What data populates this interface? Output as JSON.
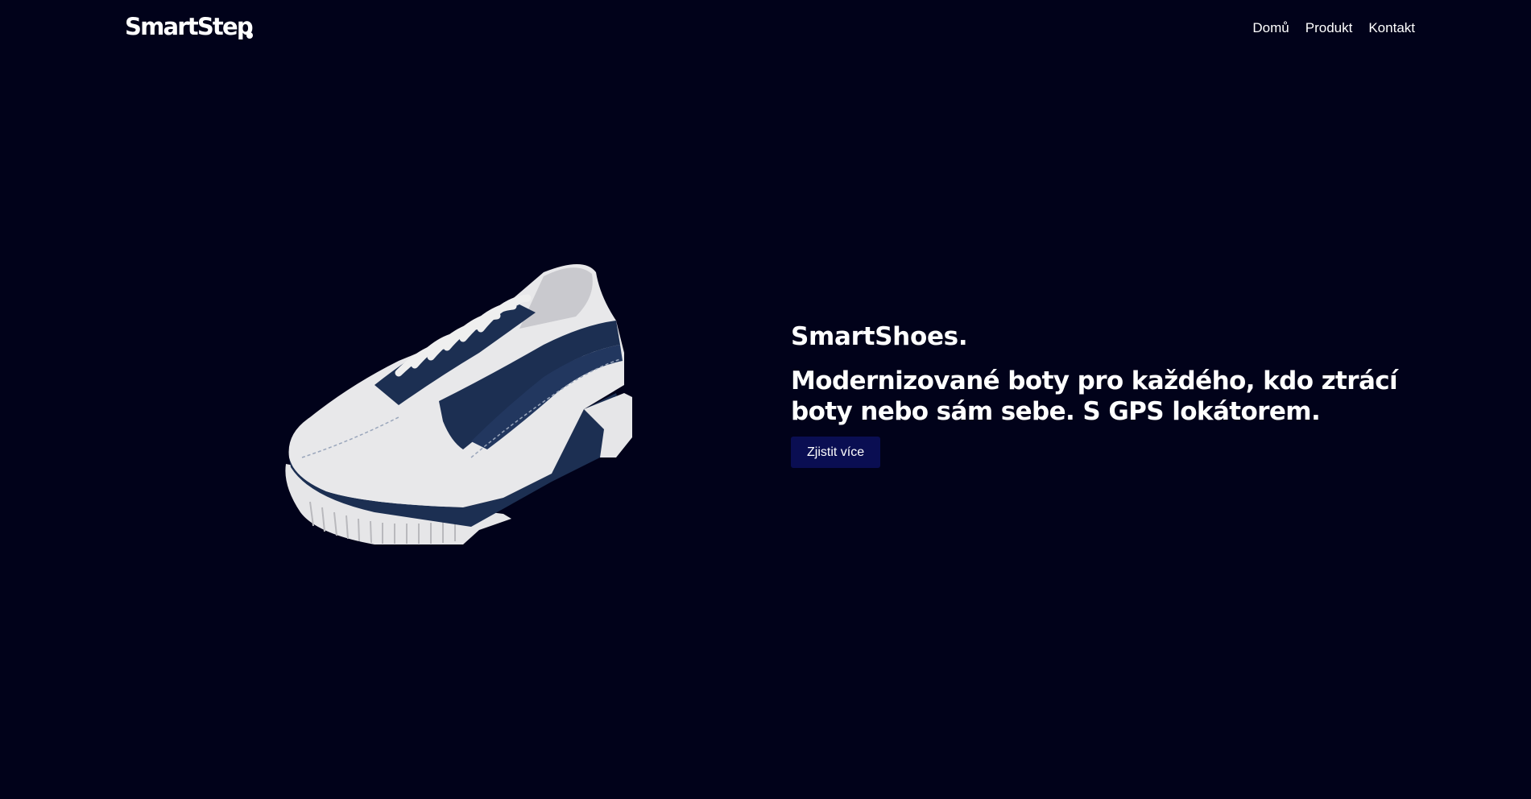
{
  "header": {
    "logo": "SmartStep",
    "nav": [
      {
        "label": "Domů"
      },
      {
        "label": "Produkt"
      },
      {
        "label": "Kontakt"
      }
    ]
  },
  "hero": {
    "title": "SmartShoes.",
    "subtitle": "Modernizované boty pro každého, kdo ztrácí boty nebo sám sebe. S GPS lokátorem.",
    "cta_label": "Zjistit více"
  },
  "image": {
    "icon": "sneaker-image",
    "colors": {
      "upper": "#e8e8ea",
      "accent": "#1c2f52",
      "sole": "#e6e6e8"
    }
  },
  "colors": {
    "background": "#01021a",
    "button": "#0a0e52",
    "text": "#ffffff"
  }
}
